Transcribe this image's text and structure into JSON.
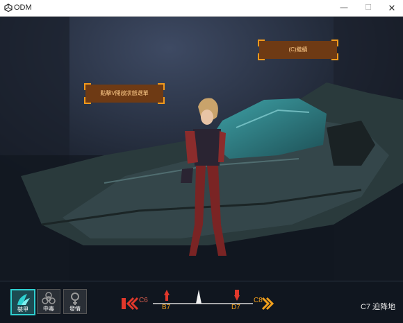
{
  "window": {
    "title": "ODM",
    "minimize": "—",
    "maximize": "☐",
    "close": "✕"
  },
  "scene_buttons": {
    "continue": "(C)繼續",
    "click_v_menu": "點擊V開啟狀態選單"
  },
  "status_icons": [
    {
      "label": "裝甲",
      "icon": "armor-icon",
      "active": true
    },
    {
      "label": "中毒",
      "icon": "biohazard-icon",
      "active": false
    },
    {
      "label": "發情",
      "icon": "female-icon",
      "active": false
    }
  ],
  "navigation": {
    "left_node": "C6",
    "right_node": "C8",
    "up_left_node": "B7",
    "down_right_node": "D7",
    "colors": {
      "red": "#e0382b",
      "orange": "#f2a01c",
      "track": "#d9d9d9"
    }
  },
  "location": "C7 迫降地"
}
